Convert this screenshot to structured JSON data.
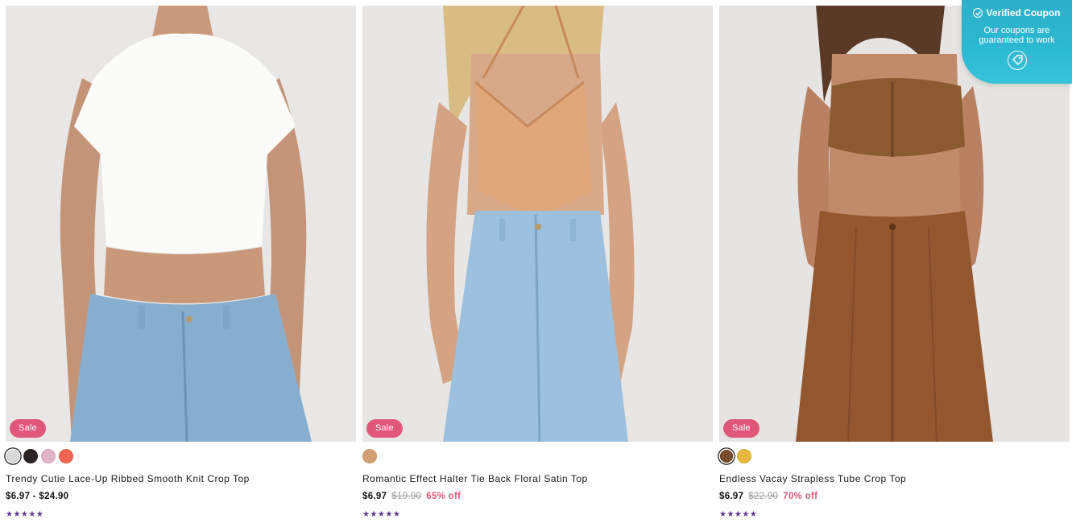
{
  "products": [
    {
      "title": "Trendy Cutie Lace-Up Ribbed Smooth Knit Crop Top",
      "price": "$6.97 - $24.90",
      "original_price": "",
      "discount": "",
      "badge": "Sale",
      "rating_stars": "★★★★★",
      "rating_value": 5,
      "swatches": [
        "#d9d9d9",
        "#2b2424",
        "#e2b3c6",
        "#ee6551"
      ]
    },
    {
      "title": "Romantic Effect Halter Tie Back Floral Satin Top",
      "price": "$6.97",
      "original_price": "$19.90",
      "discount": "65% off",
      "badge": "Sale",
      "rating_stars": "★★★★★",
      "rating_value": 5,
      "swatches": [
        "#d2a072"
      ]
    },
    {
      "title": "Endless Vacay Strapless Tube Crop Top",
      "price": "$6.97",
      "original_price": "$22.90",
      "discount": "70% off",
      "badge": "Sale",
      "rating_stars": "★★★★★",
      "rating_value": 5,
      "swatches": [
        "#6b3f22",
        "#e7b83e"
      ]
    }
  ],
  "coupon": {
    "title": "Verified Coupon",
    "subtitle": "Our coupons are guaranteed to work",
    "icon": "tag-icon"
  },
  "colors": {
    "sale_badge": "#e0577a",
    "discount_text": "#e0577a",
    "stars": "#5b3a8c",
    "coupon_bg": "#2bb8d2"
  }
}
